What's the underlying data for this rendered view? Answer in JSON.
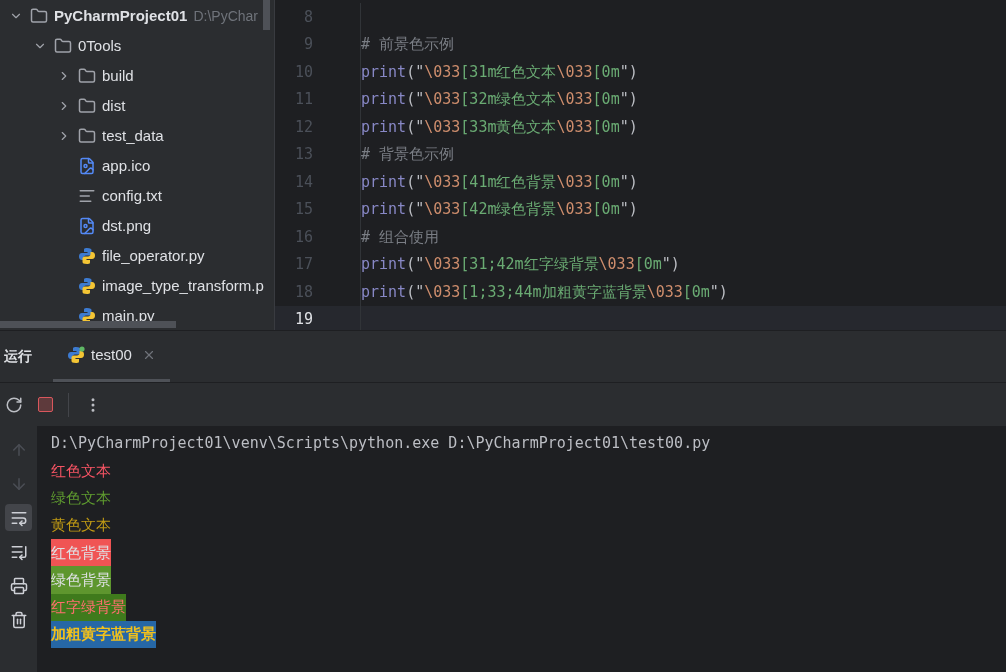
{
  "project_tree": [
    {
      "kind": "folder",
      "label": "PyCharmProject01",
      "hint": "D:\\PyChar",
      "bold": true,
      "expanded": true,
      "children": [
        {
          "kind": "folder",
          "label": "0Tools",
          "expanded": true,
          "children": [
            {
              "kind": "folder",
              "label": "build",
              "expanded": false
            },
            {
              "kind": "folder",
              "label": "dist",
              "expanded": false
            },
            {
              "kind": "folder",
              "label": "test_data",
              "expanded": false
            },
            {
              "kind": "image",
              "label": "app.ico"
            },
            {
              "kind": "text",
              "label": "config.txt"
            },
            {
              "kind": "image",
              "label": "dst.png"
            },
            {
              "kind": "python",
              "label": "file_operator.py"
            },
            {
              "kind": "python",
              "label": "image_type_transform.p"
            },
            {
              "kind": "python",
              "label": "main.py"
            }
          ]
        }
      ]
    }
  ],
  "editor": {
    "lines": [
      {
        "number": "8",
        "current": false
      },
      {
        "number": "9",
        "current": false,
        "tokens": [
          {
            "kind": "comment",
            "text": "# 前景色示例"
          }
        ]
      },
      {
        "number": "10",
        "current": false,
        "tokens": [
          {
            "kind": "func",
            "text": "print"
          },
          {
            "kind": "punct",
            "text": "(\""
          },
          {
            "kind": "escape",
            "text": "\\033"
          },
          {
            "kind": "string",
            "text": "[31m红色文本"
          },
          {
            "kind": "escape",
            "text": "\\033"
          },
          {
            "kind": "string",
            "text": "[0m"
          },
          {
            "kind": "punct",
            "text": "\")"
          }
        ]
      },
      {
        "number": "11",
        "current": false,
        "tokens": [
          {
            "kind": "func",
            "text": "print"
          },
          {
            "kind": "punct",
            "text": "(\""
          },
          {
            "kind": "escape",
            "text": "\\033"
          },
          {
            "kind": "string",
            "text": "[32m绿色文本"
          },
          {
            "kind": "escape",
            "text": "\\033"
          },
          {
            "kind": "string",
            "text": "[0m"
          },
          {
            "kind": "punct",
            "text": "\")"
          }
        ]
      },
      {
        "number": "12",
        "current": false,
        "tokens": [
          {
            "kind": "func",
            "text": "print"
          },
          {
            "kind": "punct",
            "text": "(\""
          },
          {
            "kind": "escape",
            "text": "\\033"
          },
          {
            "kind": "string",
            "text": "[33m黄色文本"
          },
          {
            "kind": "escape",
            "text": "\\033"
          },
          {
            "kind": "string",
            "text": "[0m"
          },
          {
            "kind": "punct",
            "text": "\")"
          }
        ]
      },
      {
        "number": "13",
        "current": false,
        "tokens": [
          {
            "kind": "comment",
            "text": "# 背景色示例"
          }
        ]
      },
      {
        "number": "14",
        "current": false,
        "tokens": [
          {
            "kind": "func",
            "text": "print"
          },
          {
            "kind": "punct",
            "text": "(\""
          },
          {
            "kind": "escape",
            "text": "\\033"
          },
          {
            "kind": "string",
            "text": "[41m红色背景"
          },
          {
            "kind": "escape",
            "text": "\\033"
          },
          {
            "kind": "string",
            "text": "[0m"
          },
          {
            "kind": "punct",
            "text": "\")"
          }
        ]
      },
      {
        "number": "15",
        "current": false,
        "tokens": [
          {
            "kind": "func",
            "text": "print"
          },
          {
            "kind": "punct",
            "text": "(\""
          },
          {
            "kind": "escape",
            "text": "\\033"
          },
          {
            "kind": "string",
            "text": "[42m绿色背景"
          },
          {
            "kind": "escape",
            "text": "\\033"
          },
          {
            "kind": "string",
            "text": "[0m"
          },
          {
            "kind": "punct",
            "text": "\")"
          }
        ]
      },
      {
        "number": "16",
        "current": false,
        "tokens": [
          {
            "kind": "comment",
            "text": "# 组合使用"
          }
        ]
      },
      {
        "number": "17",
        "current": false,
        "tokens": [
          {
            "kind": "func",
            "text": "print"
          },
          {
            "kind": "punct",
            "text": "(\""
          },
          {
            "kind": "escape",
            "text": "\\033"
          },
          {
            "kind": "string",
            "text": "[31;42m红字绿背景"
          },
          {
            "kind": "escape",
            "text": "\\033"
          },
          {
            "kind": "string",
            "text": "[0m"
          },
          {
            "kind": "punct",
            "text": "\")"
          }
        ]
      },
      {
        "number": "18",
        "current": false,
        "tokens": [
          {
            "kind": "func",
            "text": "print"
          },
          {
            "kind": "punct",
            "text": "(\""
          },
          {
            "kind": "escape",
            "text": "\\033"
          },
          {
            "kind": "string",
            "text": "[1;33;44m加粗黄字蓝背景"
          },
          {
            "kind": "escape",
            "text": "\\033"
          },
          {
            "kind": "string",
            "text": "[0m"
          },
          {
            "kind": "punct",
            "text": "\")"
          }
        ]
      },
      {
        "number": "19",
        "current": true
      }
    ]
  },
  "run_panel": {
    "title": "运行",
    "tabs": [
      {
        "label": "test00",
        "selected": true
      }
    ],
    "toolbar": [
      {
        "kind": "rerun"
      },
      {
        "kind": "stop"
      },
      {
        "kind": "more"
      }
    ],
    "side_tools": [
      {
        "kind": "up",
        "disabled": true,
        "selected": false
      },
      {
        "kind": "down",
        "disabled": true,
        "selected": false
      },
      {
        "kind": "wrap",
        "disabled": false,
        "selected": true
      },
      {
        "kind": "scroll-end",
        "disabled": false,
        "selected": false
      },
      {
        "kind": "print",
        "disabled": false,
        "selected": false
      },
      {
        "kind": "trash",
        "disabled": false,
        "selected": false
      }
    ],
    "output": [
      {
        "text": "D:\\PyCharmProject01\\venv\\Scripts\\python.exe D:\\PyCharmProject01\\test00.py",
        "kind": "plain"
      },
      {
        "text": "红色文本",
        "kind": "red"
      },
      {
        "text": "绿色文本",
        "kind": "green"
      },
      {
        "text": "黄色文本",
        "kind": "yellow"
      },
      {
        "text": "红色背景",
        "kind": "redbg"
      },
      {
        "text": "绿色背景",
        "kind": "greenbg"
      },
      {
        "text": "红字绿背景",
        "kind": "redongreen"
      },
      {
        "text": "加粗黄字蓝背景",
        "kind": "boldyellowonblue"
      }
    ]
  }
}
